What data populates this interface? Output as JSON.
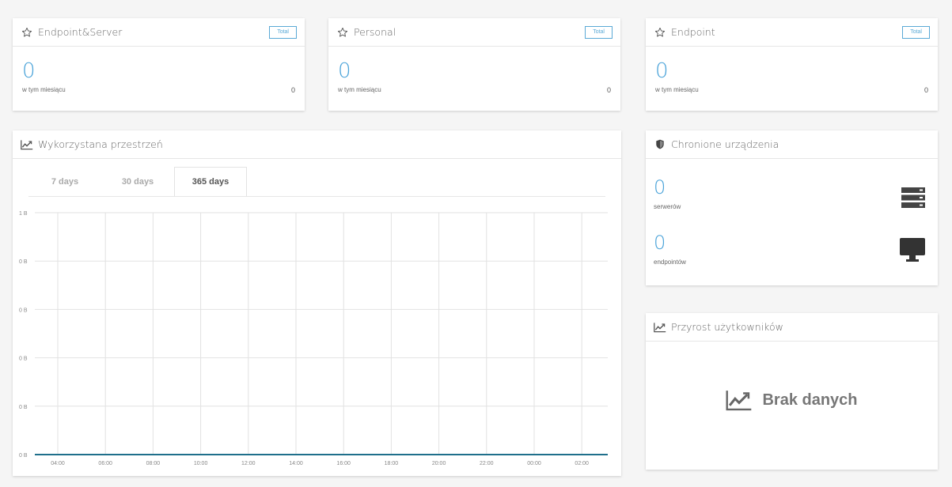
{
  "stats_cards": [
    {
      "title": "Endpoint&Server",
      "button": "Total",
      "value": "0",
      "sub_label": "w tym miesiącu",
      "sub_value": "0"
    },
    {
      "title": "Personal",
      "button": "Total",
      "value": "0",
      "sub_label": "w tym miesiącu",
      "sub_value": "0"
    },
    {
      "title": "Endpoint",
      "button": "Total",
      "value": "0",
      "sub_label": "w tym miesiącu",
      "sub_value": "0"
    }
  ],
  "storage": {
    "title": "Wykorzystana przestrzeń",
    "tabs": [
      "7 days",
      "30 days",
      "365 days"
    ],
    "active_tab": 2
  },
  "devices": {
    "title": "Chronione urządzenia",
    "servers": {
      "value": "0",
      "label": "serwerów"
    },
    "endpoints": {
      "value": "0",
      "label": "endpointów"
    }
  },
  "users_growth": {
    "title": "Przyrost użytkowników",
    "empty_text": "Brak danych"
  },
  "colors": {
    "accent": "#4aa3d9",
    "line": "#1f6f8b"
  },
  "chart_data": {
    "type": "line",
    "x": [
      "04:00",
      "06:00",
      "08:00",
      "10:00",
      "12:00",
      "14:00",
      "16:00",
      "18:00",
      "20:00",
      "22:00",
      "00:00",
      "02:00"
    ],
    "y_ticks": [
      "1 B",
      "0 B",
      "0 B",
      "0 B",
      "0 B",
      "0 B"
    ],
    "series": [
      {
        "values": [
          0,
          0,
          0,
          0,
          0,
          0,
          0,
          0,
          0,
          0,
          0,
          0
        ]
      }
    ],
    "ylim": [
      0,
      1
    ],
    "grid": true
  }
}
